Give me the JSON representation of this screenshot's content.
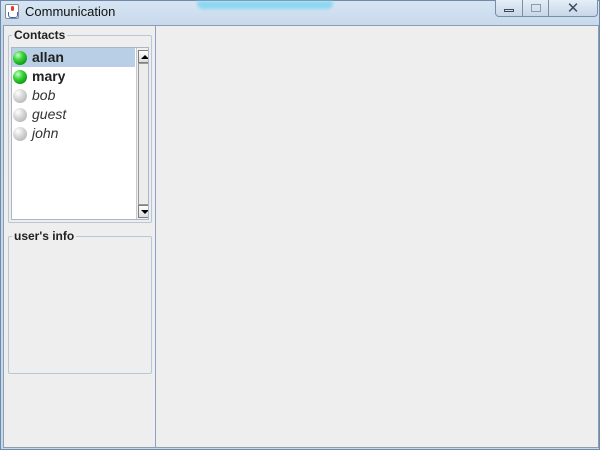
{
  "window": {
    "title": "Communication",
    "icon": "java-cup-icon",
    "controls": [
      "minimize-icon",
      "maximize-icon",
      "close-icon"
    ]
  },
  "contacts": {
    "title": "Contacts",
    "items": [
      {
        "name": "allan",
        "status": "online",
        "selected": true
      },
      {
        "name": "mary",
        "status": "online",
        "selected": false
      },
      {
        "name": "bob",
        "status": "offline",
        "selected": false
      },
      {
        "name": "guest",
        "status": "offline",
        "selected": false
      },
      {
        "name": "john",
        "status": "offline",
        "selected": false
      }
    ]
  },
  "info": {
    "title": "user's info"
  },
  "colors": {
    "online": "#2fc22f",
    "offline": "#c4c4c4",
    "selection": "#b8cfe5",
    "panel_bg": "#eeeeee"
  }
}
